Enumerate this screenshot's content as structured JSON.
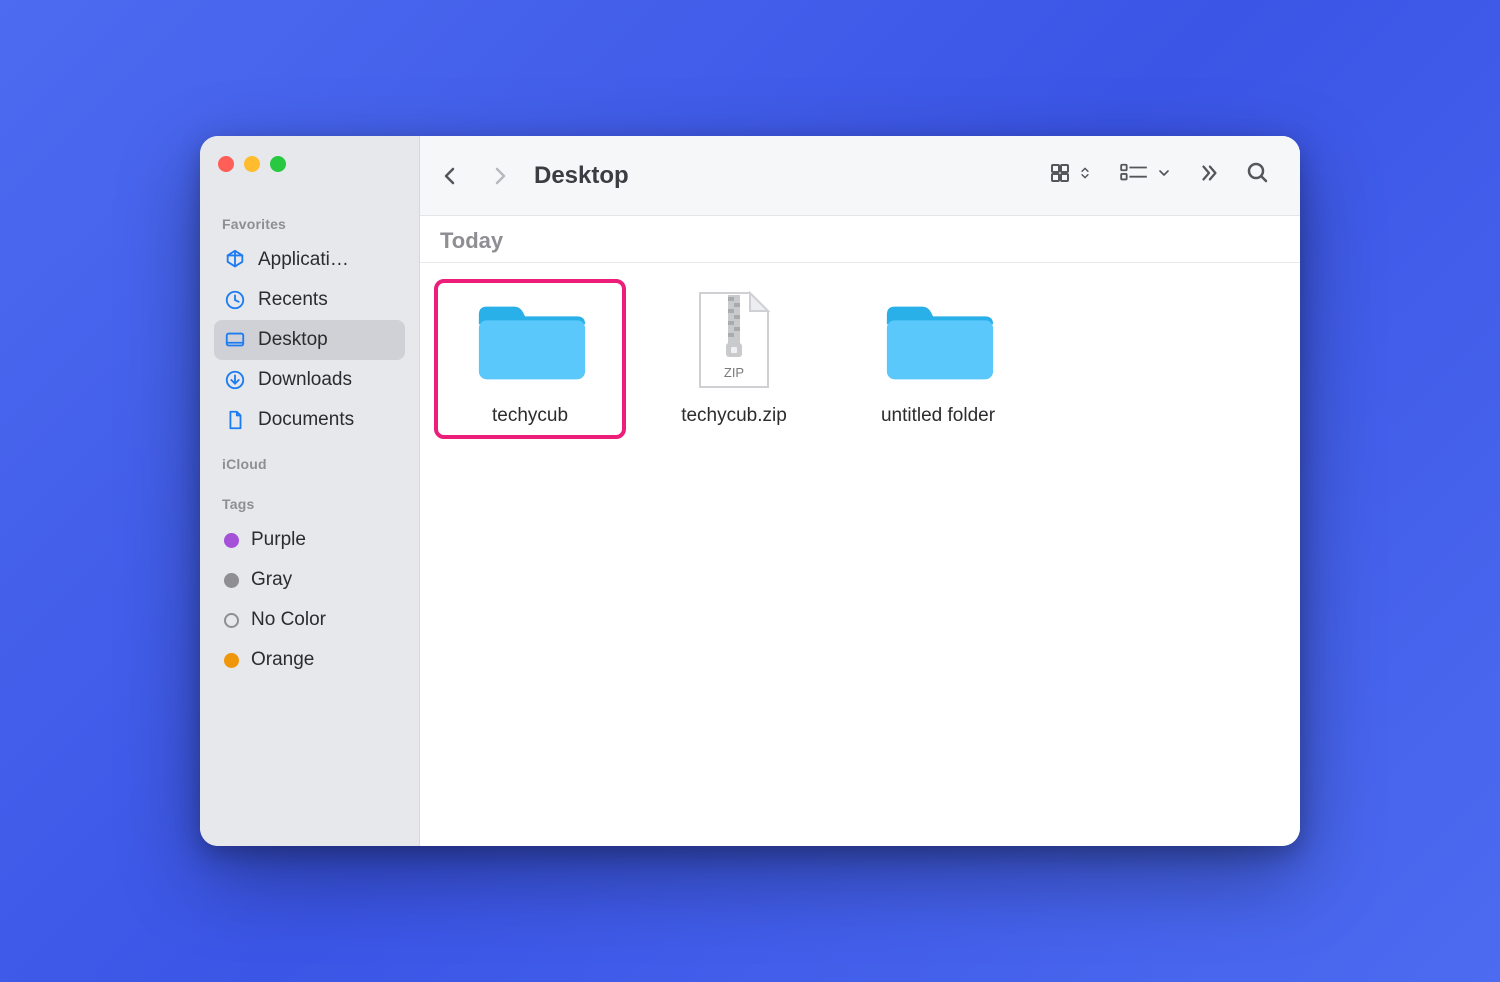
{
  "window_title": "Desktop",
  "sidebar": {
    "sections": {
      "favorites_label": "Favorites",
      "icloud_label": "iCloud",
      "tags_label": "Tags"
    },
    "favorites": [
      {
        "icon": "applications-icon",
        "label": "Applicati…"
      },
      {
        "icon": "recents-icon",
        "label": "Recents"
      },
      {
        "icon": "desktop-icon",
        "label": "Desktop",
        "active": true
      },
      {
        "icon": "downloads-icon",
        "label": "Downloads"
      },
      {
        "icon": "documents-icon",
        "label": "Documents"
      }
    ],
    "tags": [
      {
        "label": "Purple",
        "color": "#a550d8"
      },
      {
        "label": "Gray",
        "color": "#8e8e93"
      },
      {
        "label": "No Color",
        "color": ""
      },
      {
        "label": "Orange",
        "color": "#f0960a"
      }
    ]
  },
  "group": {
    "header": "Today"
  },
  "items": [
    {
      "type": "folder",
      "name": "techycub",
      "highlighted": true
    },
    {
      "type": "zip",
      "name": "techycub.zip",
      "highlighted": false
    },
    {
      "type": "folder",
      "name": "untitled folder",
      "highlighted": false
    }
  ],
  "zip_badge": "ZIP",
  "colors": {
    "folder_light": "#5ac8fa",
    "folder_dark": "#2ab0e8",
    "highlight": "#ec1e79"
  }
}
